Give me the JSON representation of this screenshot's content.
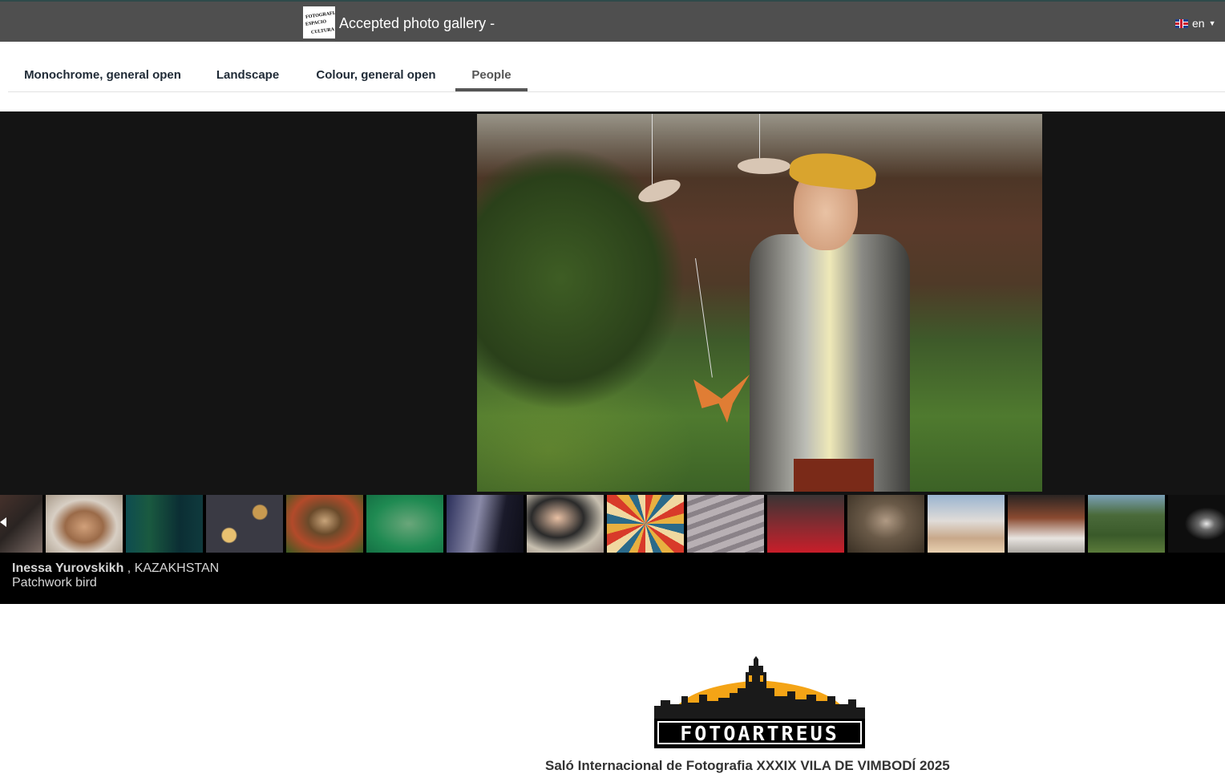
{
  "header": {
    "app_title": "Accepted photo gallery -",
    "logo_text": [
      "FOTOGRAFIA",
      "ESPACIO",
      "CULTURA"
    ],
    "language": "en"
  },
  "tabs": [
    {
      "label": "Monochrome, general open",
      "active": false
    },
    {
      "label": "Landscape",
      "active": false
    },
    {
      "label": "Colour, general open",
      "active": false
    },
    {
      "label": "People",
      "active": true
    }
  ],
  "viewer": {
    "current_photo": {
      "author": "Inessa Yurovskikh",
      "country": ", KAZAKHSTAN",
      "title": "Patchwork bird"
    }
  },
  "filmstrip": {
    "thumbnails": [
      "portrait-woman",
      "reading-boy",
      "bowls",
      "child-flower",
      "green-boy",
      "window-room",
      "woman-hat",
      "umbrellas",
      "staircase",
      "red-dress",
      "child-knit-hat",
      "beach-hands",
      "market",
      "elderly-woman",
      "mask"
    ]
  },
  "footer": {
    "brand": "FOTOARTREUS",
    "event_title": "Saló Internacional de Fotografia XXXIX VILA DE VIMBODÍ 2025"
  },
  "colors": {
    "topbar": "#4f4f4f",
    "viewer_bg": "#141414",
    "brand_orange": "#f4a416"
  }
}
